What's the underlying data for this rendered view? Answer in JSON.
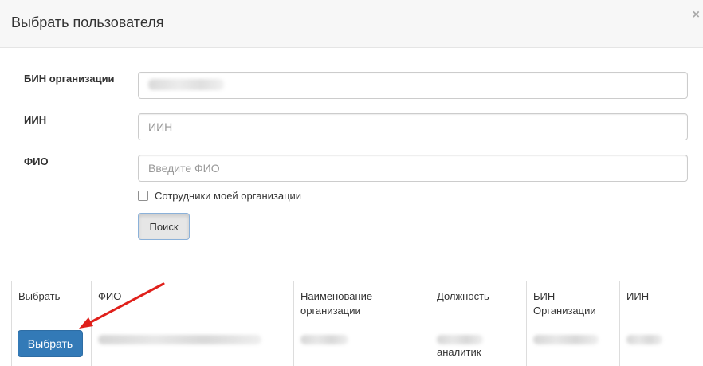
{
  "modal": {
    "title": "Выбрать пользователя",
    "close": "×"
  },
  "form": {
    "bin": {
      "label": "БИН организации",
      "value": ""
    },
    "iin": {
      "label": "ИИН",
      "placeholder": "ИИН"
    },
    "fio": {
      "label": "ФИО",
      "placeholder": "Введите ФИО"
    },
    "checkbox_label": "Сотрудники моей организации",
    "search_label": "Поиск"
  },
  "table": {
    "headers": {
      "select": "Выбрать",
      "fio": "ФИО",
      "org_name": "Наименование организации",
      "position": "Должность",
      "bin": "БИН Организации",
      "iin": "ИИН"
    },
    "rows": [
      {
        "select_label": "Выбрать",
        "position_visible": "аналитик"
      }
    ]
  },
  "colors": {
    "primary": "#337ab7",
    "annotation_arrow": "#e0201b"
  }
}
